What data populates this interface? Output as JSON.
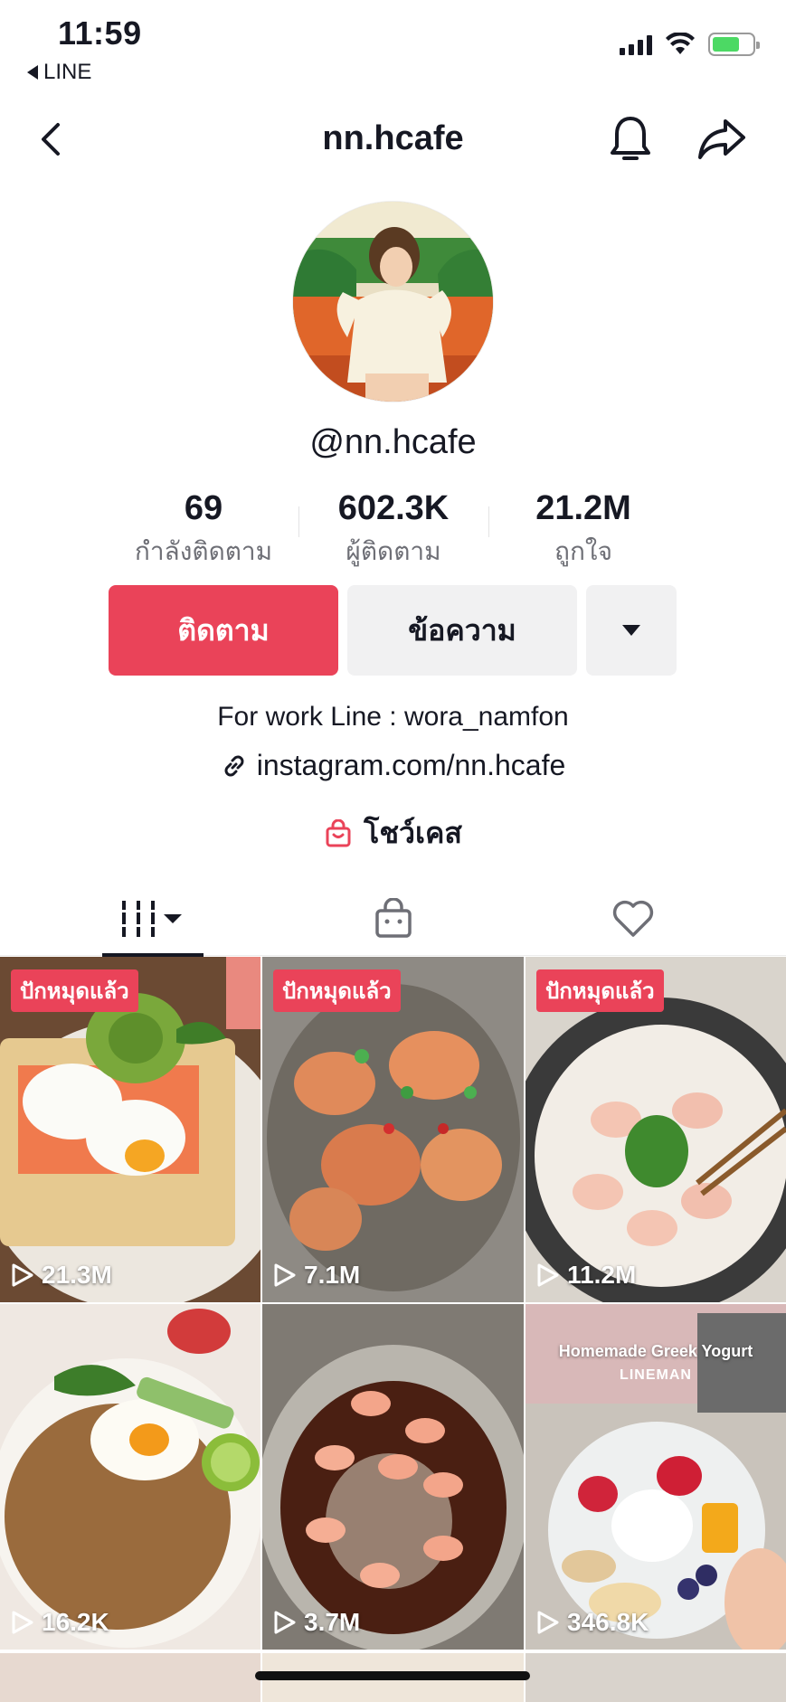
{
  "status_bar": {
    "time": "11:59",
    "back_app": "LINE"
  },
  "nav": {
    "title": "nn.hcafe",
    "back_icon": "chevron-left-icon",
    "bell_icon": "bell-icon",
    "share_icon": "share-arrow-icon"
  },
  "profile": {
    "handle": "@nn.hcafe",
    "stats": [
      {
        "value": "69",
        "label": "กำลังติดตาม"
      },
      {
        "value": "602.3K",
        "label": "ผู้ติดตาม"
      },
      {
        "value": "21.2M",
        "label": "ถูกใจ"
      }
    ],
    "follow_label": "ติดตาม",
    "message_label": "ข้อความ",
    "bio": "For work Line : wora_namfon",
    "link": "instagram.com/nn.hcafe",
    "showcase": "โชว์เคส"
  },
  "tabs": [
    {
      "name": "videos",
      "icon": "grid-icon",
      "active": true
    },
    {
      "name": "shop",
      "icon": "shopping-bag-icon",
      "active": false
    },
    {
      "name": "liked",
      "icon": "heart-icon",
      "active": false
    }
  ],
  "videos": [
    {
      "pinned": "ปักหมุดแล้ว",
      "views": "21.3M"
    },
    {
      "pinned": "ปักหมุดแล้ว",
      "views": "7.1M"
    },
    {
      "pinned": "ปักหมุดแล้ว",
      "views": "11.2M"
    },
    {
      "pinned": "",
      "views": "16.2K"
    },
    {
      "pinned": "",
      "views": "3.7M"
    },
    {
      "pinned": "",
      "views": "346.8K",
      "overlay_title": "Homemade Greek Yogurt",
      "overlay_sub": "LINEMAN"
    }
  ],
  "colors": {
    "accent": "#ea4359",
    "button_gray": "#f1f1f2",
    "text": "#161823",
    "muted": "#6e6f76"
  }
}
